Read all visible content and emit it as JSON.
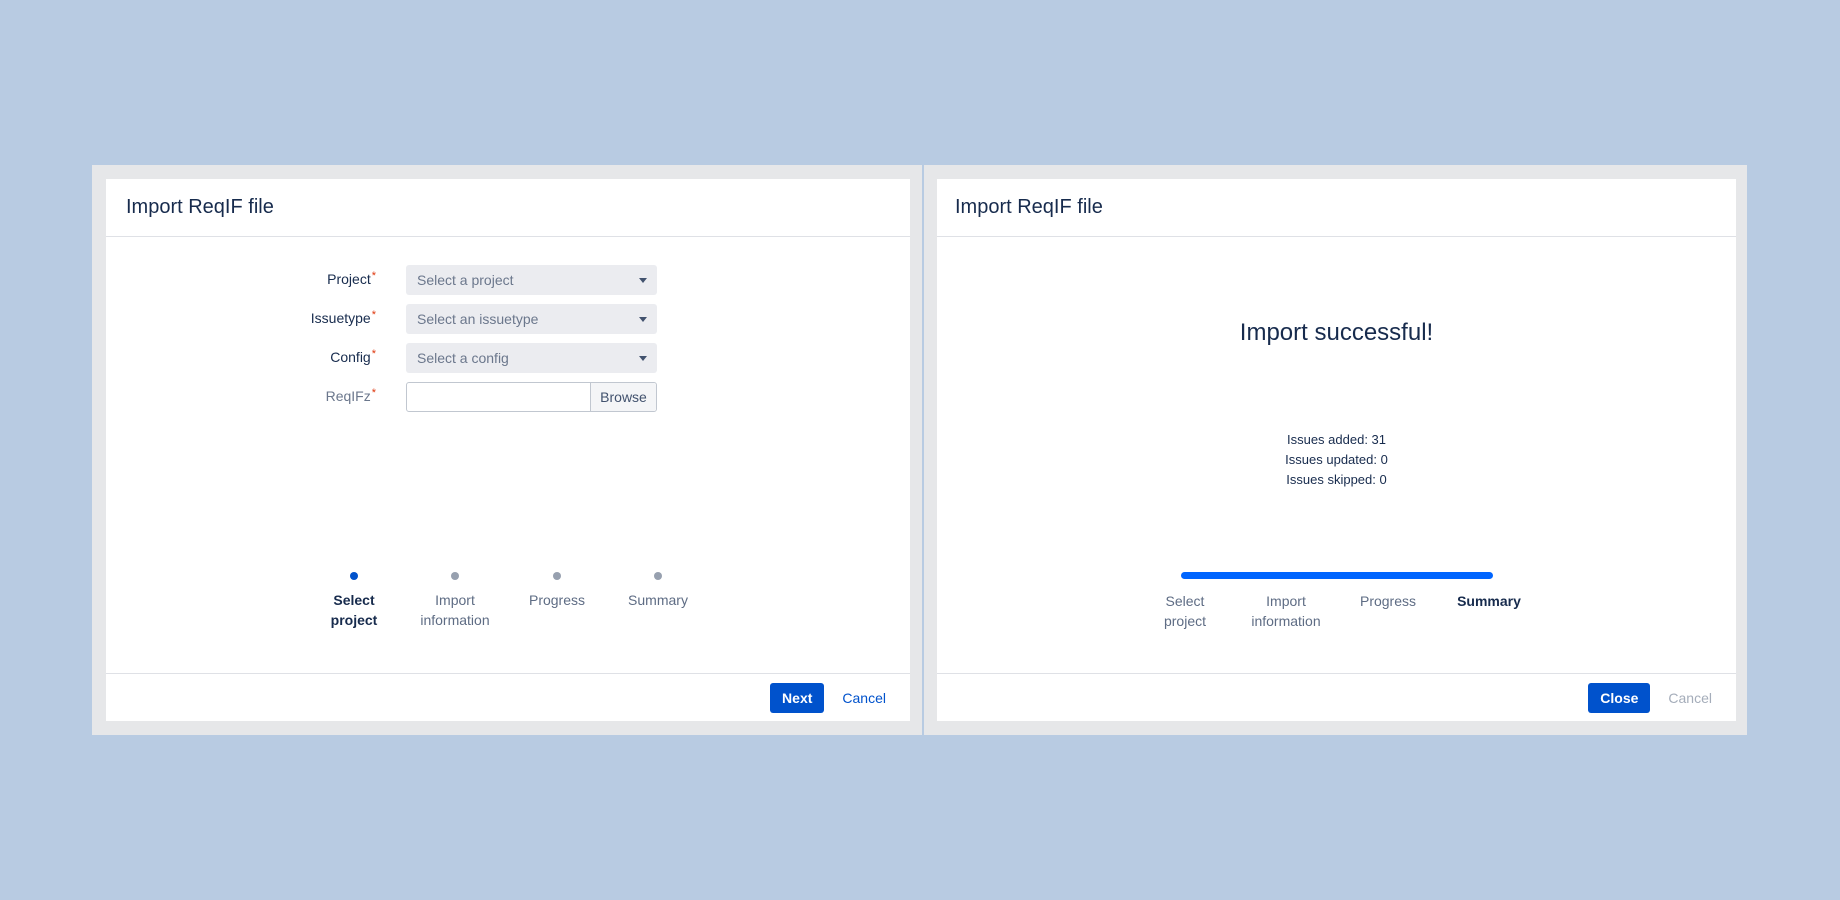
{
  "left_dialog": {
    "title": "Import ReqIF file",
    "fields": [
      {
        "label": "Project",
        "required_mark": "*",
        "placeholder": "Select a project"
      },
      {
        "label": "Issuetype",
        "required_mark": "*",
        "placeholder": "Select an issuetype"
      },
      {
        "label": "Config",
        "required_mark": "*",
        "placeholder": "Select a config"
      },
      {
        "label": "ReqIFz",
        "required_mark": "*",
        "browse_label": "Browse"
      }
    ],
    "steps": [
      {
        "line1": "Select",
        "line2": "project",
        "state": "active"
      },
      {
        "line1": "Import",
        "line2": "information",
        "state": "pending"
      },
      {
        "line1": "Progress",
        "line2": "",
        "state": "pending"
      },
      {
        "line1": "Summary",
        "line2": "",
        "state": "pending"
      }
    ],
    "footer": {
      "primary_label": "Next",
      "cancel_label": "Cancel"
    }
  },
  "right_dialog": {
    "title": "Import ReqIF file",
    "message": "Import successful!",
    "stats": [
      "Issues added: 31",
      "Issues updated: 0",
      "Issues skipped: 0"
    ],
    "progress_fraction": 1.0,
    "steps": [
      {
        "line1": "Select",
        "line2": "project",
        "state": "done"
      },
      {
        "line1": "Import",
        "line2": "information",
        "state": "done"
      },
      {
        "line1": "Progress",
        "line2": "",
        "state": "done"
      },
      {
        "line1": "Summary",
        "line2": "",
        "state": "active"
      }
    ],
    "footer": {
      "primary_label": "Close",
      "cancel_label": "Cancel"
    }
  },
  "colors": {
    "background": "#b8cbe2",
    "primary": "#0052cc",
    "progress": "#0065ff",
    "required": "#de350b"
  }
}
